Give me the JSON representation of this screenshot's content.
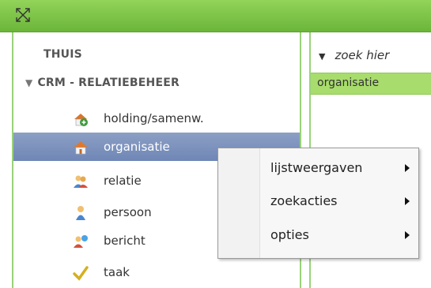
{
  "header": {
    "collapse_icon": "expand-arrows-icon",
    "bg": "#7cc347"
  },
  "sidebar": {
    "home": "THUIS",
    "section": "CRM - RELATIEBEHEER",
    "items": [
      {
        "label": "holding/samenw.",
        "icon": "house-plus-icon"
      },
      {
        "label": "organisatie",
        "icon": "house-icon",
        "selected": true
      },
      {
        "label": "relatie",
        "icon": "people-icon"
      },
      {
        "label": "persoon",
        "icon": "person-icon"
      },
      {
        "label": "bericht",
        "icon": "message-icon"
      },
      {
        "label": "taak",
        "icon": "checkmark-icon"
      }
    ]
  },
  "right_panel": {
    "search_placeholder": "zoek hier",
    "header_label": "organisatie"
  },
  "context_menu": {
    "items": [
      {
        "label": "lijstweergaven"
      },
      {
        "label": "zoekacties"
      },
      {
        "label": "opties"
      }
    ]
  }
}
